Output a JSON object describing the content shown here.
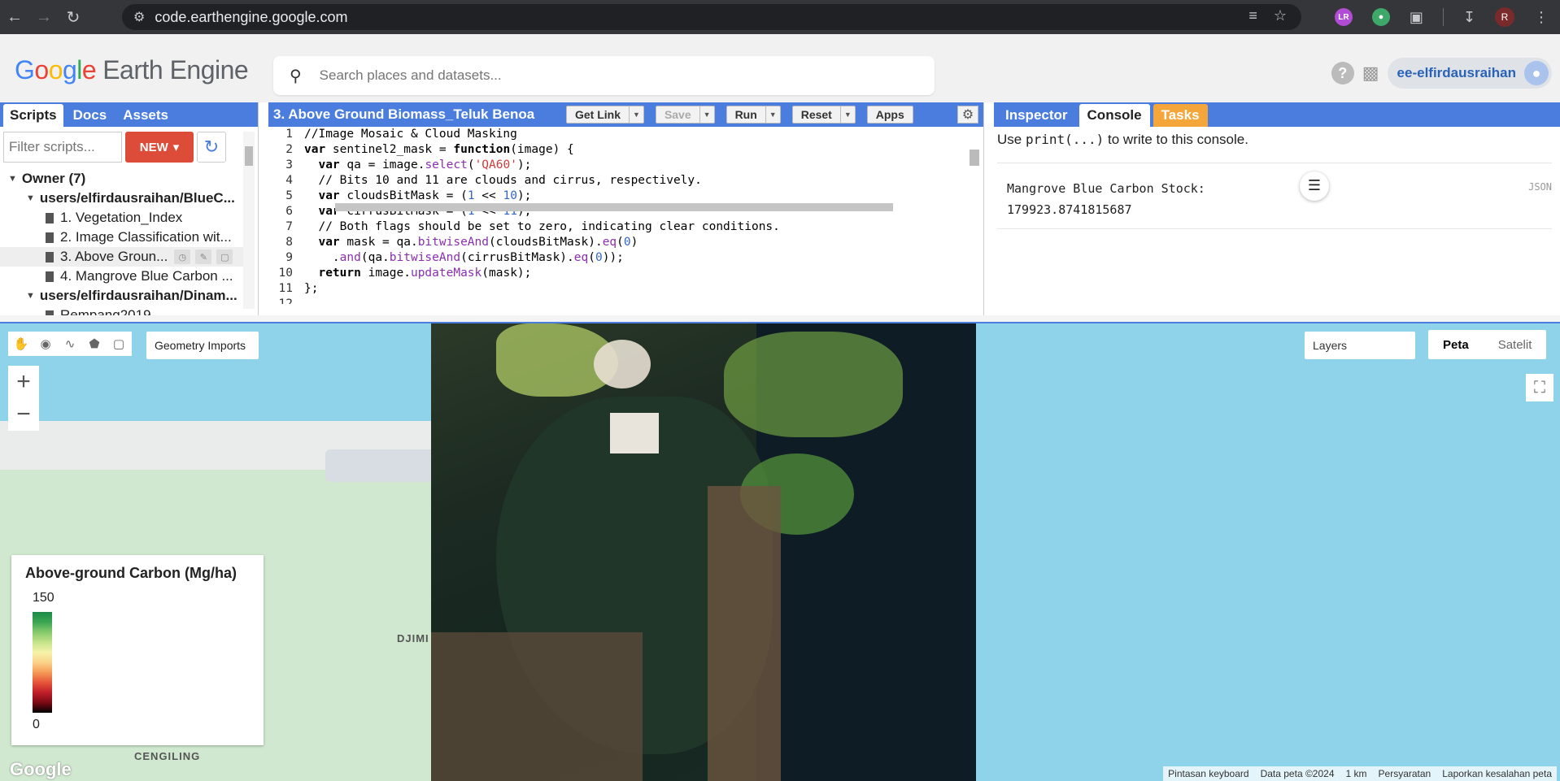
{
  "browser": {
    "url": "code.earthengine.google.com",
    "ext_lr": "LR",
    "profile": "R"
  },
  "header": {
    "logo_google": [
      "G",
      "o",
      "o",
      "g",
      "l",
      "e"
    ],
    "logo_product": "Earth Engine",
    "search_placeholder": "Search places and datasets...",
    "user": "ee-elfirdausraihan"
  },
  "left_panel": {
    "tabs": [
      "Scripts",
      "Docs",
      "Assets"
    ],
    "filter_placeholder": "Filter scripts...",
    "new_label": "NEW",
    "tree": [
      {
        "kind": "owner",
        "label": "Owner (7)"
      },
      {
        "kind": "repo",
        "label": "users/elfirdausraihan/BlueC..."
      },
      {
        "kind": "file",
        "label": "1. Vegetation_Index"
      },
      {
        "kind": "file",
        "label": "2. Image Classification wit..."
      },
      {
        "kind": "file",
        "label": "3. Above Groun...",
        "selected": true
      },
      {
        "kind": "file",
        "label": "4. Mangrove Blue Carbon ..."
      },
      {
        "kind": "repo",
        "label": "users/elfirdausraihan/Dinam..."
      },
      {
        "kind": "file",
        "label": "Rempang2019"
      }
    ]
  },
  "editor": {
    "title": "3. Above Ground Biomass_Teluk Benoa",
    "buttons": {
      "get_link": "Get Link",
      "save": "Save",
      "run": "Run",
      "reset": "Reset",
      "apps": "Apps"
    },
    "line_numbers": [
      "1",
      "2",
      "3",
      "4",
      "5",
      "6",
      "7",
      "8",
      "9",
      "10",
      "11",
      "12"
    ]
  },
  "console": {
    "tabs": [
      "Inspector",
      "Console",
      "Tasks"
    ],
    "hint_pre": "Use ",
    "hint_code": "print(...)",
    "hint_post": " to write to this console.",
    "output_label": "Mangrove Blue Carbon Stock:",
    "output_value": "179923.8741815687",
    "json_tag": "JSON"
  },
  "map": {
    "geometry_imports": "Geometry Imports",
    "layers": "Layers",
    "map_types": [
      "Peta",
      "Satelit"
    ],
    "legend_title": "Above-ground Carbon (Mg/ha)",
    "legend_max": "150",
    "legend_min": "0",
    "places": [
      "DJIMI",
      "CENGILING"
    ],
    "google": "Google",
    "attribution": [
      "Pintasan keyboard",
      "Data peta ©2024",
      "1 km",
      "Persyaratan",
      "Laporkan kesalahan peta"
    ]
  }
}
